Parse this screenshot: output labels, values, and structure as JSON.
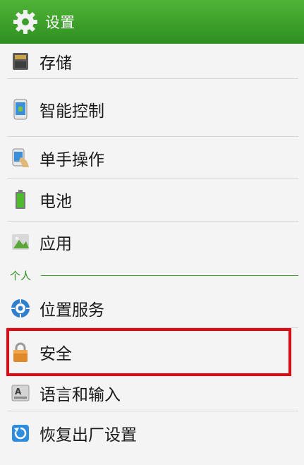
{
  "header": {
    "title": "设置",
    "icon": "gear-icon"
  },
  "items": [
    {
      "label": "存储",
      "icon": "storage-icon"
    },
    {
      "label": "智能控制",
      "icon": "phone-icon"
    },
    {
      "label": "单手操作",
      "icon": "one-hand-icon"
    },
    {
      "label": "电池",
      "icon": "battery-icon"
    },
    {
      "label": "应用",
      "icon": "apps-icon"
    }
  ],
  "section_personal": "个人",
  "personal_items": [
    {
      "label": "位置服务",
      "icon": "location-icon"
    },
    {
      "label": "安全",
      "icon": "lock-icon"
    },
    {
      "label": "语言和输入",
      "icon": "keyboard-icon"
    },
    {
      "label": "恢复出厂设置",
      "icon": "reset-icon"
    }
  ],
  "colors": {
    "header": "#3aa02a",
    "accent": "#2e8f20",
    "highlight": "#e30613"
  }
}
